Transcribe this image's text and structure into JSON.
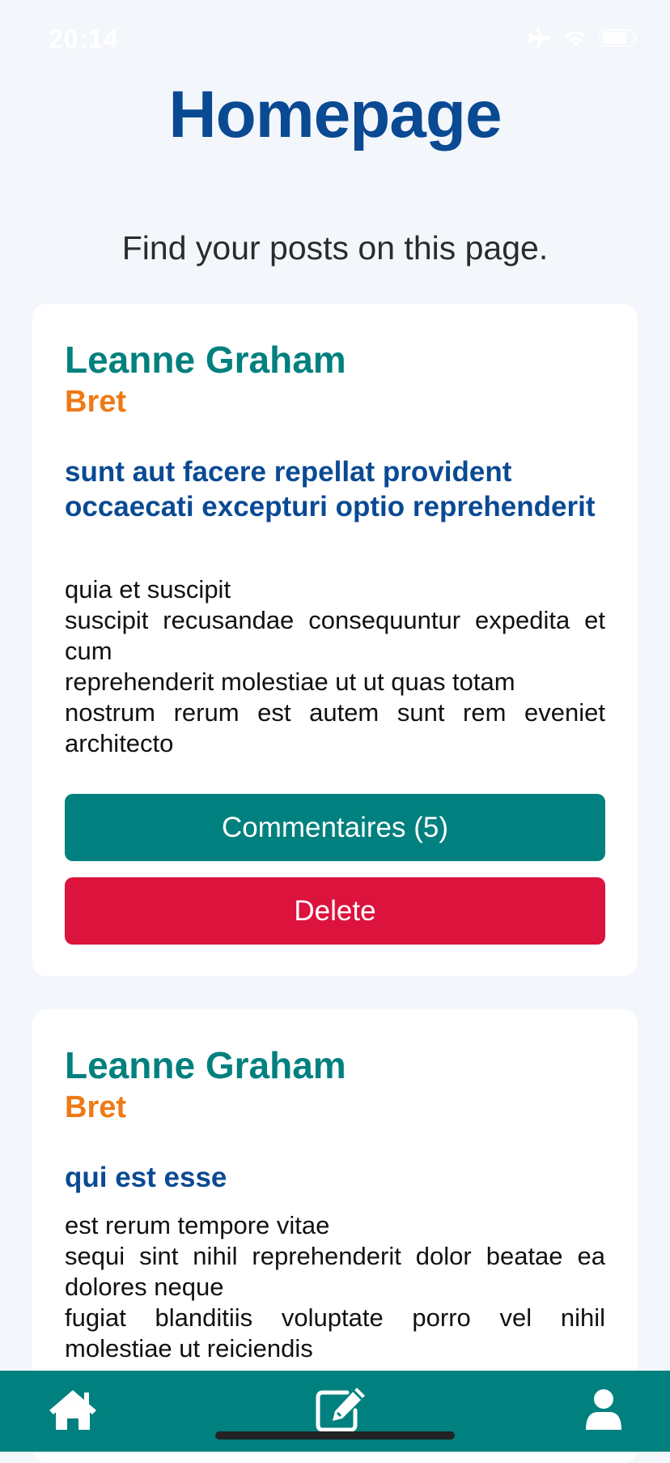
{
  "status_bar": {
    "time": "20:14",
    "icons": [
      "airplane-icon",
      "wifi-icon",
      "battery-icon"
    ]
  },
  "header": {
    "title": "Homepage",
    "subtitle": "Find your posts on this page."
  },
  "posts": [
    {
      "author_name": "Leanne Graham",
      "author_username": "Bret",
      "title": "sunt aut facere repellat provident occaecati excepturi optio reprehenderit",
      "body": "quia et suscipit\nsuscipit recusandae consequuntur expedita et cum\nreprehenderit molestiae ut ut quas totam\nnostrum rerum est autem sunt rem eveniet architecto",
      "comments_label": "Commentaires (5)",
      "delete_label": "Delete"
    },
    {
      "author_name": "Leanne Graham",
      "author_username": "Bret",
      "title": "qui est esse",
      "body": "est rerum tempore vitae\nsequi sint nihil reprehenderit dolor beatae ea dolores neque\nfugiat blanditiis voluptate porro vel nihil molestiae ut reiciendis"
    }
  ],
  "tab_bar": {
    "tabs": [
      {
        "icon": "home-icon"
      },
      {
        "icon": "edit-icon"
      },
      {
        "icon": "user-icon"
      }
    ]
  },
  "colors": {
    "title": "#0a4a93",
    "accent": "#00807e",
    "username": "#ee7a16",
    "danger": "#dc133d",
    "background": "#f3f6fb"
  }
}
